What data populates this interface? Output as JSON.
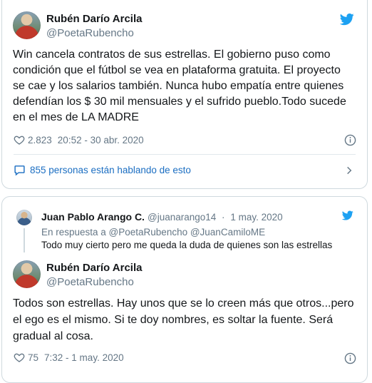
{
  "tweet1": {
    "author_name": "Rubén Darío Arcila",
    "author_handle": "@PoetaRubencho",
    "text_lines": [
      "Win cancela contratos de sus estrellas. El gobierno puso como",
      "condición que el fútbol se vea en plataforma gratuita. El proyecto",
      "se cae y los salarios también. Nunca hubo empatía  entre quienes",
      "defendían los $ 30 mil mensuales y el sufrido pueblo.Todo sucede",
      "en el mes de LA MADRE"
    ],
    "likes": "2.823",
    "timestamp": "20:52 - 30 abr. 2020",
    "talking": "855 personas están hablando de esto"
  },
  "reply": {
    "author_name": "Juan Pablo Arango C.",
    "author_handle": "@juanarango14",
    "dot": "·",
    "date": "1 may. 2020",
    "in_reply_to": "En respuesta a @PoetaRubencho @JuanCamiloME",
    "text": "Todo muy cierto pero me queda la duda de quienes son las estrellas"
  },
  "tweet2": {
    "author_name": "Rubén Darío Arcila",
    "author_handle": "@PoetaRubencho",
    "text_lines": [
      "Todos son estrellas. Hay unos que se lo creen más que otros...pero",
      "el ego es el  mismo. Si te doy nombres, es soltar la fuente. Será",
      "gradual al cosa."
    ],
    "likes": "75",
    "timestamp": "7:32 - 1 may. 2020"
  },
  "icons": {
    "bird": "twitter-bird-icon",
    "heart": "heart-icon",
    "info": "info-icon",
    "bubble": "comment-bubble-icon",
    "chevron": "chevron-right-icon"
  },
  "colors": {
    "brand": "#1da1f2",
    "link": "#1b6ec2",
    "muted": "#657786"
  }
}
